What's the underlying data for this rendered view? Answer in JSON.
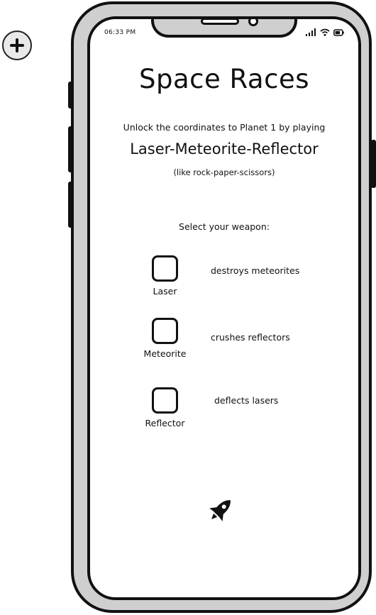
{
  "status_bar": {
    "time": "06:33 PM",
    "icons": [
      "signal-icon",
      "wifi-icon",
      "battery-icon"
    ]
  },
  "title": "Space Races",
  "intro_text": "Unlock the coordinates to Planet 1 by playing",
  "game_name": "Laser-Meteorite-Reflector",
  "hint_text": "(like rock-paper-scissors)",
  "prompt_text": "Select your weapon:",
  "weapons": [
    {
      "label": "Laser",
      "description": "destroys meteorites",
      "checked": false
    },
    {
      "label": "Meteorite",
      "description": "crushes reflectors",
      "checked": false
    },
    {
      "label": "Reflector",
      "description": "deflects lasers",
      "checked": false
    }
  ],
  "icons": {
    "add": "plus-circle-icon",
    "launch": "rocket-icon"
  }
}
